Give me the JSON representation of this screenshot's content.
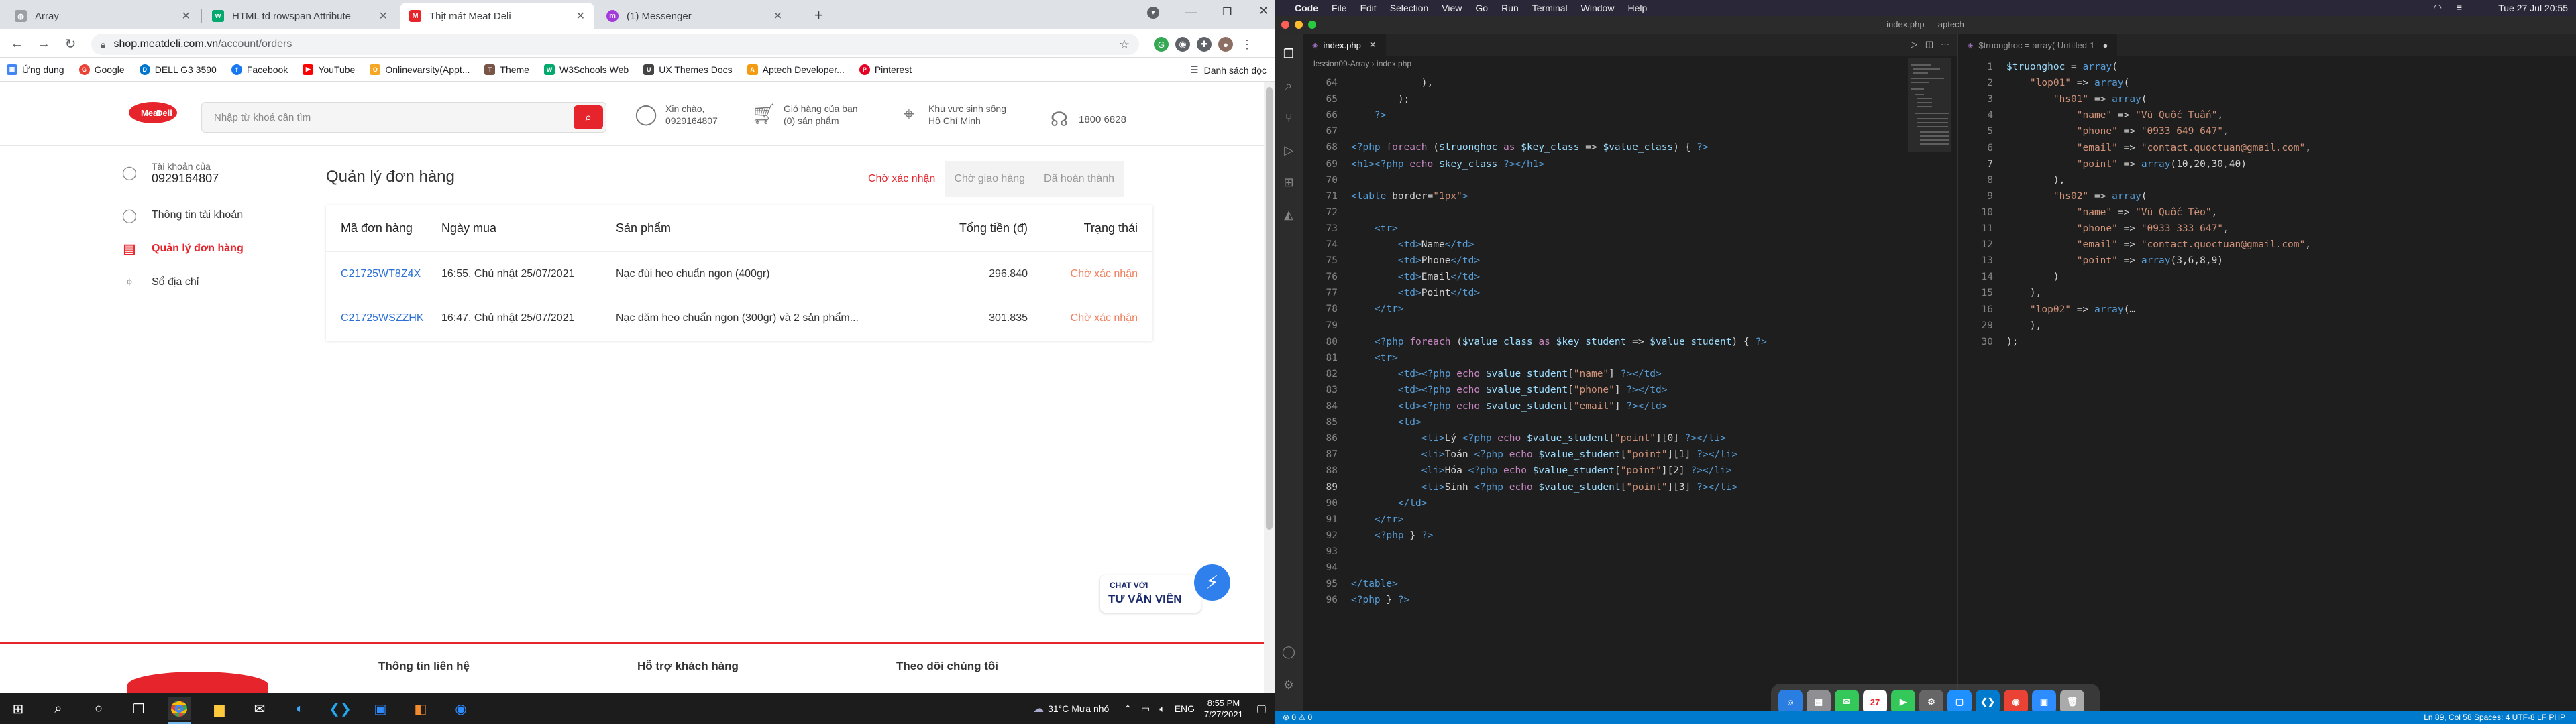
{
  "chrome": {
    "tabs": [
      {
        "title": "Array",
        "color": "#9aa0a6"
      },
      {
        "title": "HTML td rowspan Attribute",
        "color": "#04aa6d"
      },
      {
        "title": "Thịt mát Meat Deli",
        "color": "#e5242b"
      },
      {
        "title": "(1) Messenger",
        "color": "#a33bdb"
      }
    ],
    "url_host": "shop.meatdeli.com.vn",
    "url_path": "/account/orders",
    "bookmarks": [
      "Ứng dụng",
      "Google",
      "DELL G3 3590",
      "Facebook",
      "YouTube",
      "Onlinevarsity(Appt...",
      "Theme",
      "W3Schools Web",
      "UX Themes Docs",
      "Aptech Developer...",
      "Pinterest"
    ],
    "reading_list": "Danh sách đọc"
  },
  "site": {
    "logo_text": "Meat Deli",
    "search_placeholder": "Nhập từ khoá cần tìm",
    "greeting_line1": "Xin chào,",
    "greeting_line2": "0929164807",
    "cart_line1": "Giỏ hàng của bạn",
    "cart_line2": "(0) sản phẩm",
    "area_line1": "Khu vực sinh sống",
    "area_line2": "Hồ Chí Minh",
    "hotline": "1800 6828",
    "account_label": "Tài khoản của",
    "account_phone": "0929164807",
    "menu": [
      "Thông tin tài khoản",
      "Quản lý đơn hàng",
      "Sổ địa chỉ"
    ],
    "order_title": "Quản lý đơn hàng",
    "order_tabs": [
      "Chờ xác nhận",
      "Chờ giao hàng",
      "Đã hoàn thành"
    ],
    "table_headers": [
      "Mã đơn hàng",
      "Ngày mua",
      "Sản phẩm",
      "Tổng tiền (đ)",
      "Trạng thái"
    ],
    "orders": [
      {
        "code": "C21725WT8Z4X",
        "date": "16:55, Chủ nhật 25/07/2021",
        "product": "Nạc đùi heo chuẩn ngon (400gr)",
        "total": "296.840",
        "status": "Chờ xác nhận"
      },
      {
        "code": "C21725WSZZHK",
        "date": "16:47, Chủ nhật 25/07/2021",
        "product": "Nạc dăm heo chuẩn ngon (300gr) và 2 sản phẩm...",
        "total": "301.835",
        "status": "Chờ xác nhận"
      }
    ],
    "chat_line1": "CHAT VỚI",
    "chat_line2": "TƯ VẤN VIÊN",
    "footer": [
      "Thông tin liên hệ",
      "Hỗ trợ khách hàng",
      "Theo dõi chúng tôi"
    ],
    "brand_color": "#e5242b"
  },
  "taskbar": {
    "weather": "31°C  Mưa nhỏ",
    "lang": "ENG",
    "time": "8:55 PM",
    "date": "7/27/2021"
  },
  "mac": {
    "menus": [
      "Code",
      "File",
      "Edit",
      "Selection",
      "View",
      "Go",
      "Run",
      "Terminal",
      "Window",
      "Help"
    ],
    "clock": "Tue 27 Jul 20:55",
    "window_title": "index.php — aptech",
    "left_tab": "index.php",
    "left_crumbs": "lession09-Array  ›  index.php",
    "right_tab": "$truonghoc = array( Untitled-1",
    "status_left": "⊗ 0 ⚠ 0",
    "status_right": "Ln 89, Col 58   Spaces: 4   UTF-8   LF   PHP"
  },
  "code_left": [
    {
      "n": "64",
      "html": "            ),"
    },
    {
      "n": "65",
      "html": "        );"
    },
    {
      "n": "66",
      "html": "    ?>"
    },
    {
      "n": "67",
      "html": ""
    },
    {
      "n": "68",
      "html": "<?php foreach ($truonghoc as $key_class => $value_class) { ?>"
    },
    {
      "n": "69",
      "html": "<h1><?php echo $key_class ?></h1>"
    },
    {
      "n": "70",
      "html": ""
    },
    {
      "n": "71",
      "html": "<table border=\"1px\">"
    },
    {
      "n": "72",
      "html": ""
    },
    {
      "n": "73",
      "html": "    <tr>"
    },
    {
      "n": "74",
      "html": "        <td>Name</td>"
    },
    {
      "n": "75",
      "html": "        <td>Phone</td>"
    },
    {
      "n": "76",
      "html": "        <td>Email</td>"
    },
    {
      "n": "77",
      "html": "        <td>Point</td>"
    },
    {
      "n": "78",
      "html": "    </tr>"
    },
    {
      "n": "79",
      "html": ""
    },
    {
      "n": "80",
      "html": "    <?php foreach ($value_class as $key_student => $value_student) { ?>"
    },
    {
      "n": "81",
      "html": "    <tr>"
    },
    {
      "n": "82",
      "html": "        <td><?php echo $value_student[\"name\"] ?></td>"
    },
    {
      "n": "83",
      "html": "        <td><?php echo $value_student[\"phone\"] ?></td>"
    },
    {
      "n": "84",
      "html": "        <td><?php echo $value_student[\"email\"] ?></td>"
    },
    {
      "n": "85",
      "html": "        <td>"
    },
    {
      "n": "86",
      "html": "            <li>Lý <?php echo $value_student[\"point\"][0] ?></li>"
    },
    {
      "n": "87",
      "html": "            <li>Toán <?php echo $value_student[\"point\"][1] ?></li>"
    },
    {
      "n": "88",
      "html": "            <li>Hóa <?php echo $value_student[\"point\"][2] ?></li>"
    },
    {
      "n": "89",
      "html": "            <li>Sinh <?php echo $value_student[\"point\"][3] ?></li>"
    },
    {
      "n": "90",
      "html": "        </td>"
    },
    {
      "n": "91",
      "html": "    </tr>"
    },
    {
      "n": "92",
      "html": "    <?php } ?>"
    },
    {
      "n": "93",
      "html": ""
    },
    {
      "n": "94",
      "html": ""
    },
    {
      "n": "95",
      "html": "</table>"
    },
    {
      "n": "96",
      "html": "<?php } ?>"
    }
  ],
  "code_right": [
    {
      "n": "1",
      "html": "$truonghoc = array("
    },
    {
      "n": "2",
      "html": "    \"lop01\" => array("
    },
    {
      "n": "3",
      "html": "        \"hs01\" => array("
    },
    {
      "n": "4",
      "html": "            \"name\" => \"Vũ Quốc Tuấn\","
    },
    {
      "n": "5",
      "html": "            \"phone\" => \"0933 649 647\","
    },
    {
      "n": "6",
      "html": "            \"email\" => \"contact.quoctuan@gmail.com\","
    },
    {
      "n": "7",
      "html": "            \"point\" => array(10,20,30,40)"
    },
    {
      "n": "8",
      "html": "        ),"
    },
    {
      "n": "9",
      "html": "        \"hs02\" => array("
    },
    {
      "n": "10",
      "html": "            \"name\" => \"Vũ Quốc Tèo\","
    },
    {
      "n": "11",
      "html": "            \"phone\" => \"0933 333 647\","
    },
    {
      "n": "12",
      "html": "            \"email\" => \"contact.quoctuan@gmail.com\","
    },
    {
      "n": "13",
      "html": "            \"point\" => array(3,6,8,9)"
    },
    {
      "n": "14",
      "html": "        )"
    },
    {
      "n": "15",
      "html": "    ),"
    },
    {
      "n": "16",
      "html": "    \"lop02\" => array(…"
    },
    {
      "n": "29",
      "html": "    ),"
    },
    {
      "n": "30",
      "html": ");"
    }
  ]
}
